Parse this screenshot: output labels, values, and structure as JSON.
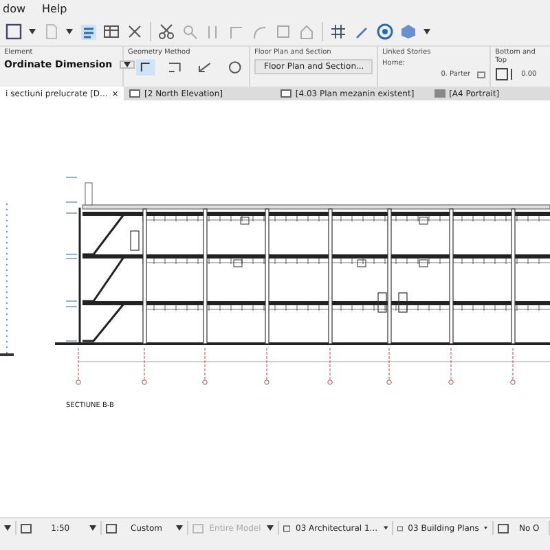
{
  "menu": [
    {
      "label": "dow"
    },
    {
      "label": "Help"
    }
  ],
  "info_box": {
    "element": {
      "heading": "Element",
      "value": "Ordinate Dimension"
    },
    "geometry": {
      "heading": "Geometry Method"
    },
    "floor_plan": {
      "heading": "Floor Plan and Section",
      "value": "Floor Plan and Section..."
    },
    "linked_stories": {
      "heading": "Linked Stories",
      "story": "Home:",
      "home_value": "0. Parter"
    },
    "bottom_top": {
      "heading": "Bottom and Top",
      "value": "0.00"
    }
  },
  "tabs": [
    {
      "label": "i sectiuni prelucrate [D...",
      "close": "×",
      "selected": true
    },
    {
      "label": "[2 North Elevation]",
      "selected": false
    },
    {
      "label": "[4.03 Plan mezanin existent]",
      "selected": false
    },
    {
      "label": "[A4 Portrait]",
      "selected": false
    }
  ],
  "drawing": {
    "title": "SECTIUNE B-B"
  },
  "status_bar": [
    {
      "label": "1:50",
      "disabled": false
    },
    {
      "label": "Custom",
      "disabled": false
    },
    {
      "label": "Entire Model",
      "disabled": true
    },
    {
      "label": "03 Architectural 1...",
      "disabled": false
    },
    {
      "label": "03 Building Plans",
      "disabled": false
    },
    {
      "label": "No O",
      "disabled": false
    }
  ]
}
